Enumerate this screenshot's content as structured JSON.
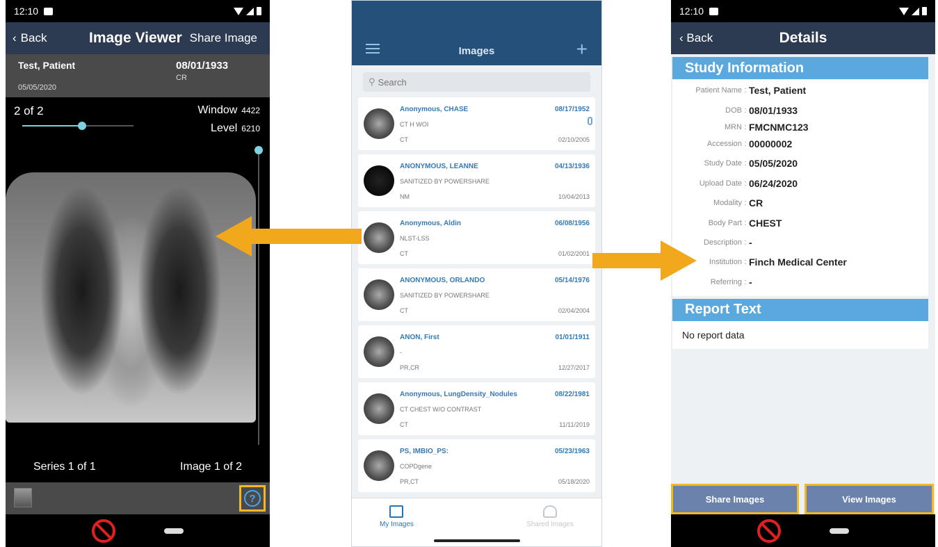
{
  "viewer": {
    "status_time": "12:10",
    "back_label": "Back",
    "title": "Image Viewer",
    "share_label": "Share Image",
    "patient_name": "Test, Patient",
    "patient_dob": "08/01/1933",
    "study_date": "05/05/2020",
    "modality": "CR",
    "image_count": "2 of 2",
    "window_label": "Window",
    "window_value": "4422",
    "level_label": "Level",
    "level_value": "6210",
    "series_label": "Series 1 of 1",
    "image_label": "Image 1 of 2",
    "help_icon_glyph": "?"
  },
  "list": {
    "title": "Images",
    "search_placeholder": "Search",
    "rows": [
      {
        "name": "Anonymous, CHASE",
        "dob": "08/17/1952",
        "desc": "CT H WOI",
        "modality": "CT",
        "date": "02/10/2005"
      },
      {
        "name": "ANONYMOUS, LEANNE",
        "dob": "04/13/1936",
        "desc": "SANITIZED BY POWERSHARE",
        "modality": "NM",
        "date": "10/04/2013"
      },
      {
        "name": "Anonymous, Aldin",
        "dob": "06/08/1956",
        "desc": "NLST-LSS",
        "modality": "CT",
        "date": "01/02/2001"
      },
      {
        "name": "ANONYMOUS, ORLANDO",
        "dob": "05/14/1976",
        "desc": "SANITIZED BY POWERSHARE",
        "modality": "CT",
        "date": "02/04/2004"
      },
      {
        "name": "ANON, First",
        "dob": "01/01/1911",
        "desc": "-",
        "modality": "PR,CR",
        "date": "12/27/2017"
      },
      {
        "name": "Anonymous, LungDensity_Nodules",
        "dob": "08/22/1981",
        "desc": "CT CHEST W/O CONTRAST",
        "modality": "CT",
        "date": "11/11/2019"
      },
      {
        "name": "PS, IMBIO_PS:",
        "dob": "05/23/1963",
        "desc": "COPDgene",
        "modality": "PR,CT",
        "date": "05/18/2020"
      }
    ],
    "tab_mine": "My Images",
    "tab_shared": "Shared Images"
  },
  "details": {
    "status_time": "12:10",
    "back_label": "Back",
    "title": "Details",
    "study_header": "Study Information",
    "fields": [
      {
        "label": "Patient Name",
        "value": "Test, Patient"
      },
      {
        "label": "DOB",
        "value": "08/01/1933"
      },
      {
        "label": "MRN",
        "value": "FMCNMC123"
      },
      {
        "label": "Accession",
        "value": "00000002"
      },
      {
        "label": "Study Date",
        "value": "05/05/2020"
      },
      {
        "label": "Upload Date",
        "value": "06/24/2020"
      },
      {
        "label": "Modality",
        "value": "CR"
      },
      {
        "label": "Body Part",
        "value": "CHEST"
      },
      {
        "label": "Description",
        "value": "-"
      },
      {
        "label": "Institution",
        "value": "Finch Medical Center"
      },
      {
        "label": "Referring",
        "value": "-"
      }
    ],
    "report_header": "Report Text",
    "report_text": "No report data",
    "share_button": "Share Images",
    "view_button": "View Images"
  },
  "colors": {
    "nav_dark": "#2c3a52",
    "list_header": "#24507a",
    "section_blue": "#5aa8de",
    "highlight": "#f2b825",
    "arrow": "#f2a81d",
    "link_blue": "#3479b8"
  },
  "icons": [
    "wifi-icon",
    "signal-icon",
    "battery-icon",
    "menu-icon",
    "plus-icon",
    "search-icon",
    "paperclip-icon",
    "help-icon",
    "block-icon",
    "my-images-icon",
    "shared-images-icon",
    "back-chevron-icon"
  ]
}
